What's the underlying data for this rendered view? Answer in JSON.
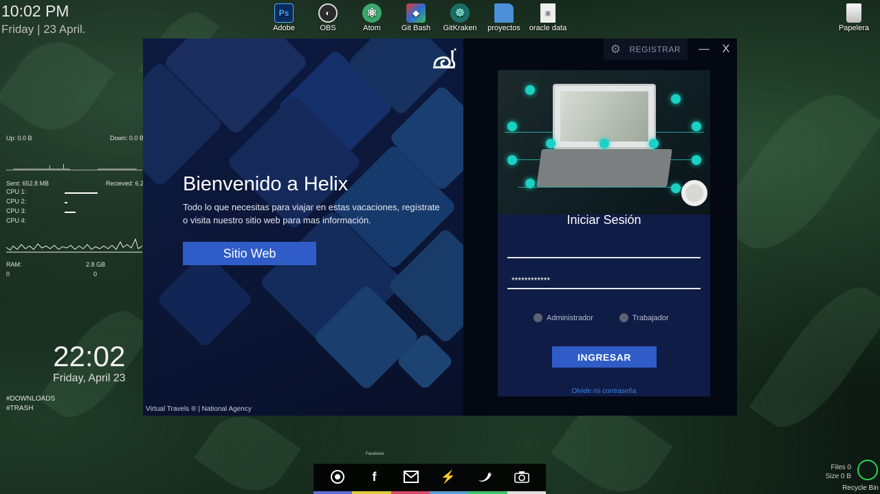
{
  "desktop": {
    "clock_top": {
      "time": "10:02 PM",
      "date": "Friday | 23 April."
    },
    "stats": {
      "up": "Up: 0.0 B",
      "down": "Down:  0.0 B",
      "sent": "Sent:  652.8 MB",
      "received": "Recieved: 6.2",
      "cpu": [
        "CPU 1:",
        "CPU 2:",
        "CPU 3:",
        "CPU 4:"
      ],
      "ram_label": "RAM:",
      "ram_value": "2.8 GB",
      "zero_left": "0",
      "zero_right": "0"
    },
    "clock_mid": {
      "time": "22:02",
      "date": "Friday, April 23"
    },
    "tags": [
      "#DOWNLOADS",
      "#TRASH"
    ],
    "icons": [
      {
        "label": "Adobe",
        "icon": "photoshop-icon",
        "color": "#0b2b5e",
        "glyph": "Ps"
      },
      {
        "label": "OBS",
        "icon": "obs-icon",
        "color": "#2b2b2b",
        "glyph": "◐"
      },
      {
        "label": "Atom",
        "icon": "atom-icon",
        "color": "#3aa86a",
        "glyph": "⚛"
      },
      {
        "label": "Git Bash",
        "icon": "git-bash-icon",
        "color": "#2a6bd6",
        "glyph": "◆"
      },
      {
        "label": "GitKraken",
        "icon": "gitkraken-icon",
        "color": "#1b6e66",
        "glyph": "☸"
      },
      {
        "label": "proyectos",
        "icon": "folder-icon",
        "color": "#4a8fd8",
        "glyph": "▬"
      },
      {
        "label": "oracle data",
        "icon": "document-icon",
        "color": "#e8e8e8",
        "glyph": "≡"
      }
    ],
    "trash": {
      "label": "Papelera"
    },
    "dock_label": "Facebook",
    "files_info": [
      "Files 0",
      "Size 0 B"
    ],
    "recycle_label": "Recycle Bin",
    "dock_colors": [
      "#5b6fd6",
      "#e0cc3a",
      "#d94b6b",
      "#5aa0d6",
      "#3dc46a",
      "#e0e0e0"
    ]
  },
  "app": {
    "left": {
      "title": "Bienvenido a Helix",
      "description": "Todo lo que necesitas para viajar en estas vacaciones, regístrate o visita nuestro sitio web para mas información.",
      "web_button": "Sitio Web",
      "footer": "Virtual Travels ®  |    National Agency"
    },
    "topbar": {
      "register": "REGISTRAR",
      "minimize": "—",
      "close": "X"
    },
    "login": {
      "title": "Iniciar Sesión",
      "username_value": "",
      "password_value": "************",
      "radio_admin": "Administrador",
      "radio_worker": "Trabajador",
      "submit": "INGRESAR",
      "forgot": "Olvide mi contraseña"
    }
  }
}
